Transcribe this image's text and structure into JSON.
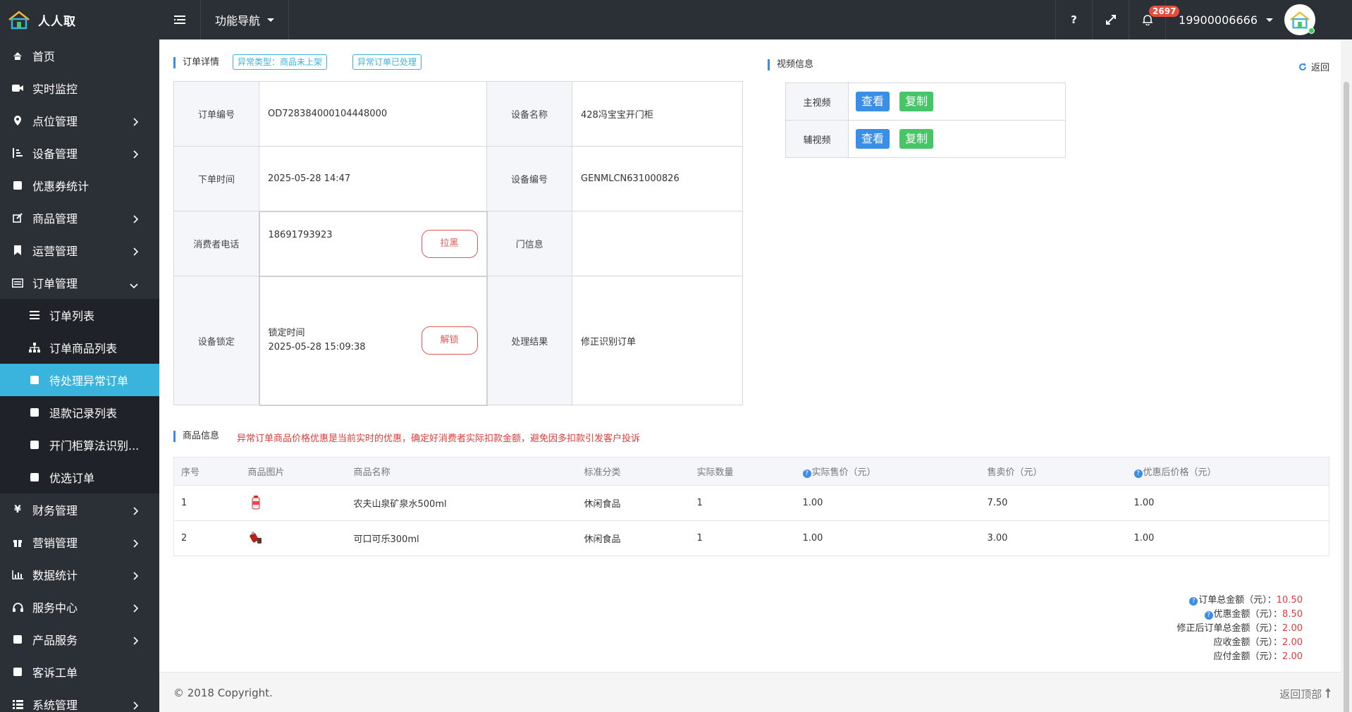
{
  "brand": {
    "name": "人人取"
  },
  "topbar": {
    "func_nav": "功能导航",
    "help": "?",
    "notifications": "2697",
    "user": "19900006666"
  },
  "sidebar": {
    "items": [
      {
        "label": "首页"
      },
      {
        "label": "实时监控"
      },
      {
        "label": "点位管理"
      },
      {
        "label": "设备管理"
      },
      {
        "label": "优惠券统计"
      },
      {
        "label": "商品管理"
      },
      {
        "label": "运营管理"
      },
      {
        "label": "订单管理"
      }
    ],
    "sub_items": [
      {
        "label": "订单列表"
      },
      {
        "label": "订单商品列表"
      },
      {
        "label": "待处理异常订单"
      },
      {
        "label": "退款记录列表"
      },
      {
        "label": "开门柜算法识别..."
      },
      {
        "label": "优选订单"
      }
    ],
    "items_after": [
      {
        "label": "财务管理"
      },
      {
        "label": "营销管理"
      },
      {
        "label": "数据统计"
      },
      {
        "label": "服务中心"
      },
      {
        "label": "产品服务"
      },
      {
        "label": "客诉工单"
      },
      {
        "label": "系统管理"
      }
    ]
  },
  "order": {
    "title": "订单详情",
    "tag_type": "异常类型：商品未上架",
    "tag_status": "异常订单已处理",
    "rows": {
      "order_no_label": "订单编号",
      "order_no": "OD728384000104448000",
      "device_name_label": "设备名称",
      "device_name": "428冯宝宝开门柜",
      "order_time_label": "下单时间",
      "order_time": "2025-05-28 14:47",
      "device_no_label": "设备编号",
      "device_no": "GENMLCN631000826",
      "phone_label": "消费者电话",
      "phone": "18691793923",
      "blacklist_btn": "拉黑",
      "door_label": "门信息",
      "door": "",
      "lock_label": "设备锁定",
      "lock_time_label": "锁定时间",
      "lock_time": "2025-05-28 15:09:38",
      "unlock_btn": "解锁",
      "result_label": "处理结果",
      "result": "修正识别订单"
    }
  },
  "video": {
    "title": "视频信息",
    "back": "返回",
    "main_label": "主视频",
    "sub_label": "辅视频",
    "view_btn": "查看",
    "copy_btn": "复制"
  },
  "goods": {
    "title": "商品信息",
    "warning": "异常订单商品价格优惠是当前实时的优惠，确定好消费者实际扣款金额，避免因多扣款引发客户投诉",
    "headers": [
      "序号",
      "商品图片",
      "商品名称",
      "标准分类",
      "实际数量",
      "实际售价（元）",
      "售卖价（元）",
      "优惠后价格（元）"
    ],
    "rows": [
      {
        "no": "1",
        "name": "农夫山泉矿泉水500ml",
        "category": "休闲食品",
        "qty": "1",
        "actual": "1.00",
        "sell": "7.50",
        "discounted": "1.00"
      },
      {
        "no": "2",
        "name": "可口可乐300ml",
        "category": "休闲食品",
        "qty": "1",
        "actual": "1.00",
        "sell": "3.00",
        "discounted": "1.00"
      }
    ]
  },
  "totals": {
    "total_label": "订单总金额（元）：",
    "total": "10.50",
    "discount_label": "优惠金额（元）：",
    "discount": "8.50",
    "fixed_label": "修正后订单总金额（元）：",
    "fixed": "2.00",
    "receivable_label": "应收金额（元）：",
    "receivable": "2.00",
    "payable_label": "应付金额（元）：",
    "payable": "2.00"
  },
  "footer": {
    "copyright": "© 2018 Copyright.",
    "to_top": "返回顶部"
  },
  "colors": {
    "accent": "#3a8ee6",
    "active": "#3ab4dd",
    "danger": "#e03c3c",
    "success": "#47c567",
    "sidebar": "#2b2f36"
  }
}
